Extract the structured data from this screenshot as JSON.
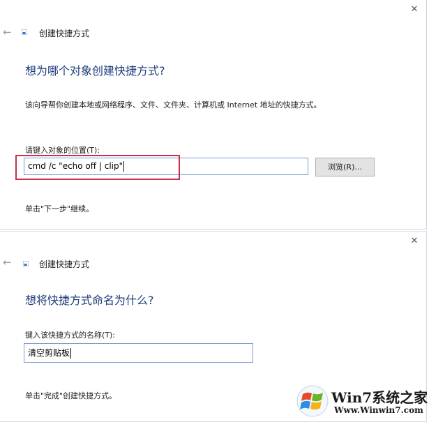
{
  "dialog1": {
    "close_glyph": "✕",
    "back_glyph": "←",
    "title": "创建快捷方式",
    "heading": "想为哪个对象创建快捷方式?",
    "description": "该向导帮你创建本地或网络程序、文件、文件夹、计算机或 Internet 地址的快捷方式。",
    "field_label": "请键入对象的位置(T):",
    "field_value": "cmd /c \"echo off | clip\"",
    "browse_label": "浏览(R)...",
    "hint": "单击\"下一步\"继续。",
    "highlight_color": "#c8324a"
  },
  "dialog2": {
    "close_glyph": "✕",
    "back_glyph": "←",
    "title": "创建快捷方式",
    "heading": "想将快捷方式命名为什么?",
    "field_label": "键入该快捷方式的名称(T):",
    "field_value": "清空剪贴板",
    "hint": "单击\"完成\"创建快捷方式。"
  },
  "watermark": {
    "brand": "Win7系统之家",
    "url": "Www.Winwin7.com"
  },
  "colors": {
    "heading": "#1d3c7a",
    "input_border": "#7a9cd3",
    "button_bg": "#e3e3e3"
  },
  "icons": {
    "close": "close-icon",
    "back": "back-arrow-icon",
    "app": "shortcut-wizard-icon",
    "logo": "windows-logo-icon"
  }
}
